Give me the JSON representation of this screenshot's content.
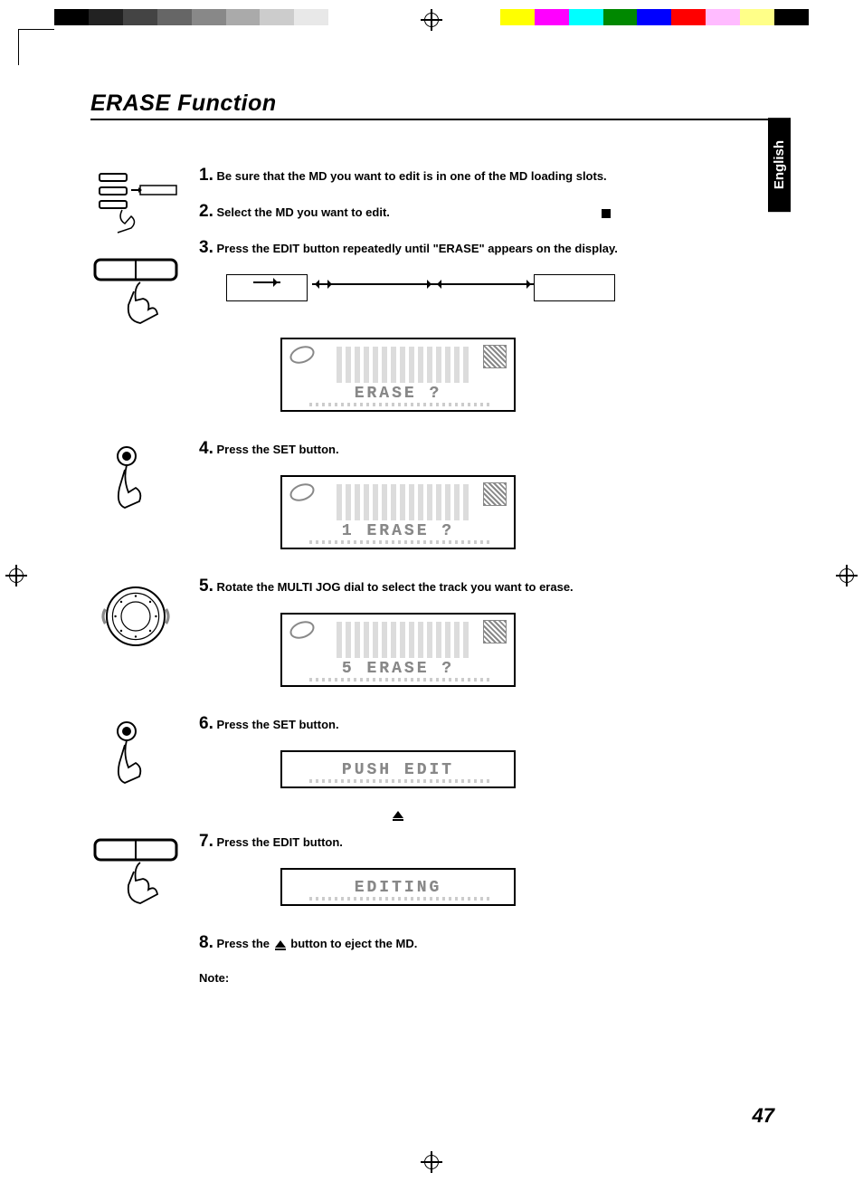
{
  "title": "ERASE Function",
  "language_tab": "English",
  "page_number": "47",
  "steps": {
    "s1": {
      "num": "1.",
      "text": "Be sure that the MD you want to edit is in one of the MD loading slots."
    },
    "s2": {
      "num": "2.",
      "text": "Select the MD you want to edit."
    },
    "s3": {
      "num": "3.",
      "text": "Press the EDIT button repeatedly  until \"ERASE\" appears on the display."
    },
    "s4": {
      "num": "4.",
      "text": "Press the SET button."
    },
    "s5": {
      "num": "5.",
      "text": "Rotate the MULTI JOG dial to select the track you want to erase."
    },
    "s6": {
      "num": "6.",
      "text": "Press the SET button."
    },
    "s7": {
      "num": "7.",
      "text": "Press the EDIT button."
    },
    "s8": {
      "num": "8.",
      "text_before": "Press the ",
      "text_after": " button to eject the MD."
    }
  },
  "lcd": {
    "d1": "ERASE ?",
    "d2": "1 ERASE ?",
    "d3": "5 ERASE ?",
    "d4": "PUSH EDIT",
    "d5": "EDITING"
  },
  "note_label": "Note:"
}
